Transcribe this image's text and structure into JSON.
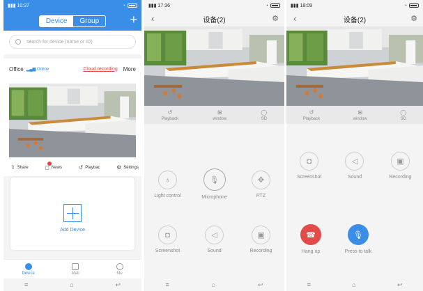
{
  "phone1": {
    "time": "10:37",
    "seg_device": "Device",
    "seg_group": "Group",
    "search_placeholder": "search for device (name or ID)",
    "device_name": "Office",
    "online_status": "Online",
    "cloud_recording": "Cloud recording",
    "more": "More",
    "actions": {
      "share": "Share",
      "news": "News",
      "playback": "Playbac",
      "settings": "Settings"
    },
    "add_device": "Add Device",
    "tabs": {
      "device": "Device",
      "mall": "Mall",
      "me": "Me"
    }
  },
  "phone2": {
    "time": "17:36",
    "title": "设备(2)",
    "bar": {
      "playback": "Playback",
      "window": "window",
      "sd": "SD"
    },
    "controls": {
      "light": "Light control",
      "microphone": "Microphone",
      "ptz": "PTZ",
      "screenshot": "Screenshot",
      "sound": "Sound",
      "recording": "Recording"
    }
  },
  "phone3": {
    "time": "18:09",
    "title": "设备(2)",
    "bar": {
      "playback": "Playback",
      "window": "window",
      "sd": "SD"
    },
    "controls": {
      "screenshot": "Screenshot",
      "sound": "Sound",
      "recording": "Recording",
      "hangup": "Hang up",
      "talk": "Press to talk"
    }
  },
  "colors": {
    "accent": "#3a8ee8",
    "danger": "#e34a4a"
  }
}
